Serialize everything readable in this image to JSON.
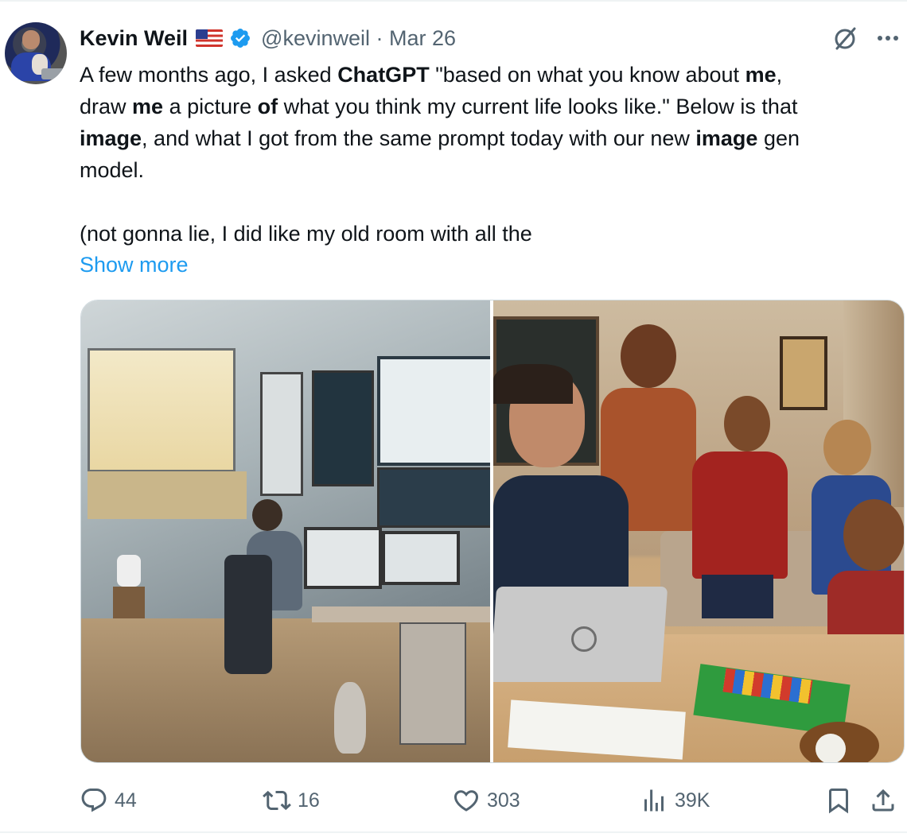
{
  "tweet": {
    "author_name": "Kevin Weil",
    "handle_date": "@kevinweil · Mar 26",
    "text_lines": [
      [
        {
          "t": "A few months ago, I asked ",
          "b": false
        },
        {
          "t": "ChatGPT",
          "b": true
        },
        {
          "t": " \"based on what you know about ",
          "b": false
        },
        {
          "t": "me",
          "b": true
        },
        {
          "t": ",",
          "b": false
        }
      ],
      [
        {
          "t": "draw ",
          "b": false
        },
        {
          "t": "me",
          "b": true
        },
        {
          "t": " a picture ",
          "b": false
        },
        {
          "t": "of",
          "b": true
        },
        {
          "t": " what you think my current life looks like.\" Below is that",
          "b": false
        }
      ],
      [
        {
          "t": "image",
          "b": true
        },
        {
          "t": ", and what I got from the same prompt today with our new ",
          "b": false
        },
        {
          "t": "image",
          "b": true
        },
        {
          "t": " gen",
          "b": false
        }
      ],
      [
        {
          "t": "model.",
          "b": false
        }
      ],
      [],
      [
        {
          "t": "(not gonna lie, I did like my old room with all the",
          "b": false
        }
      ]
    ],
    "show_more": "Show more"
  },
  "actions": {
    "replies": "44",
    "reposts": "16",
    "likes": "303",
    "views": "39K"
  },
  "icons": [
    "verified-badge-icon",
    "us-flag-icon",
    "grok-icon",
    "more-icon",
    "reply-icon",
    "repost-icon",
    "like-icon",
    "views-icon",
    "bookmark-icon",
    "share-icon"
  ],
  "colors": {
    "accent": "#1d9bf0",
    "secondary_text": "#536471",
    "text": "#0f1419"
  }
}
